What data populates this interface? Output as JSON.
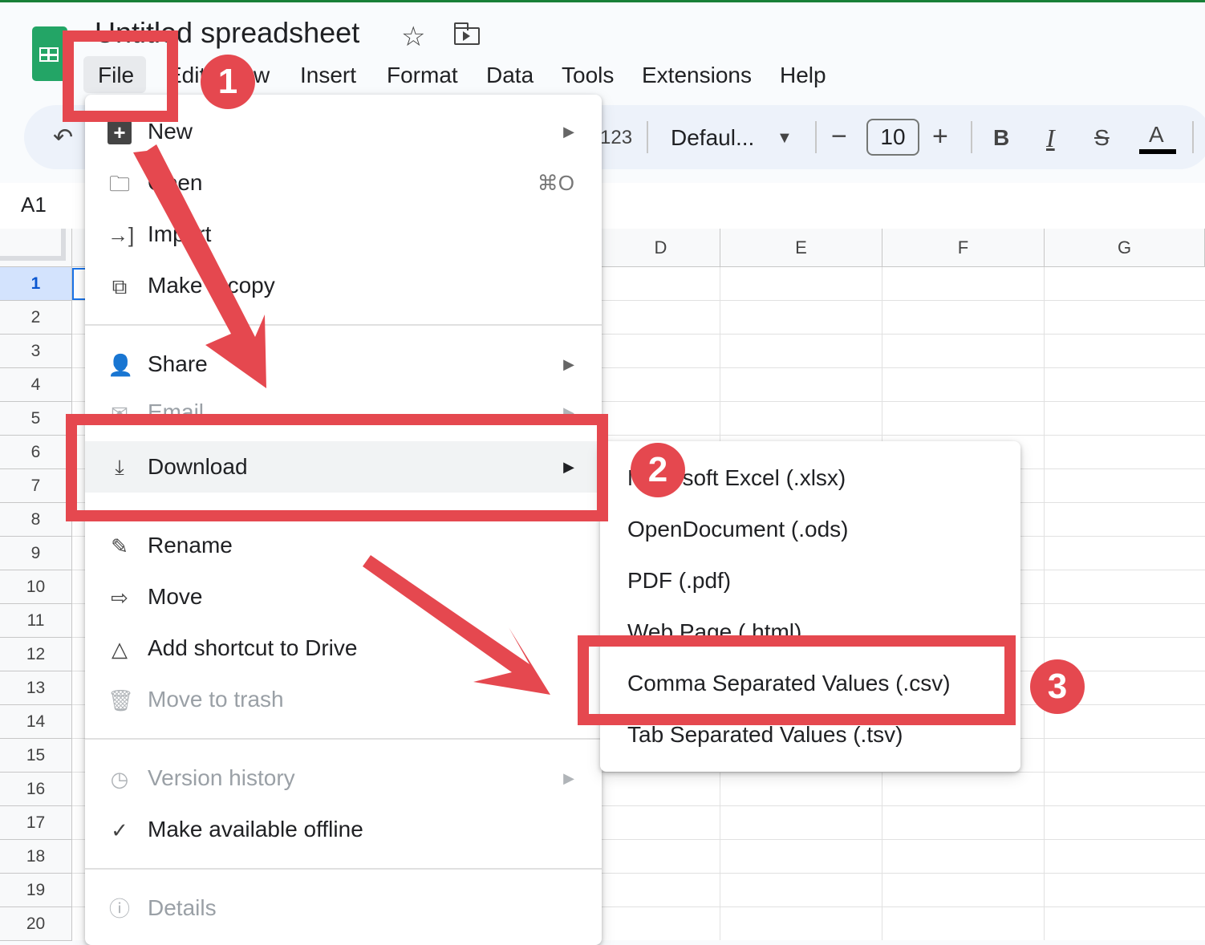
{
  "app": {
    "doc_title": "Untitled spreadsheet",
    "star_icon": "star-icon",
    "move_icon": "folder-move-icon"
  },
  "menubar": [
    "File",
    "Edit",
    "View",
    "Insert",
    "Format",
    "Data",
    "Tools",
    "Extensions",
    "Help"
  ],
  "toolbar": {
    "undo_icon": "undo-icon",
    "format_label": "123",
    "font_name": "Defaul...",
    "decrease_icon": "minus-icon",
    "font_size": "10",
    "increase_icon": "plus-icon",
    "bold": "B",
    "italic": "I",
    "strike": "S",
    "text_color": "A"
  },
  "name_box": "A1",
  "columns": [
    "D",
    "E",
    "F",
    "G"
  ],
  "rows": [
    "1",
    "2",
    "3",
    "4",
    "5",
    "6",
    "7",
    "8",
    "9",
    "10",
    "11",
    "12",
    "13",
    "14",
    "15",
    "16",
    "17",
    "18",
    "19",
    "20"
  ],
  "file_menu": {
    "new": "New",
    "open": "Open",
    "open_shortcut": "⌘O",
    "import": "Import",
    "make_copy": "Make a copy",
    "share": "Share",
    "email": "Email",
    "download": "Download",
    "rename": "Rename",
    "move": "Move",
    "add_shortcut": "Add shortcut to Drive",
    "move_to_trash": "Move to trash",
    "version_history": "Version history",
    "make_offline": "Make available offline",
    "details": "Details"
  },
  "download_submenu": {
    "xlsx": "Microsoft Excel (.xlsx)",
    "ods": "OpenDocument (.ods)",
    "pdf": "PDF (.pdf)",
    "html": "Web Page (.html)",
    "csv": "Comma Separated Values (.csv)",
    "tsv": "Tab Separated Values (.tsv)"
  },
  "annotations": {
    "step1": "1",
    "step2": "2",
    "step3": "3",
    "color": "#e5484f"
  },
  "colors": {
    "accent": "#188038",
    "selection": "#1a73e8",
    "toolbar_bg": "#edf2fa"
  }
}
